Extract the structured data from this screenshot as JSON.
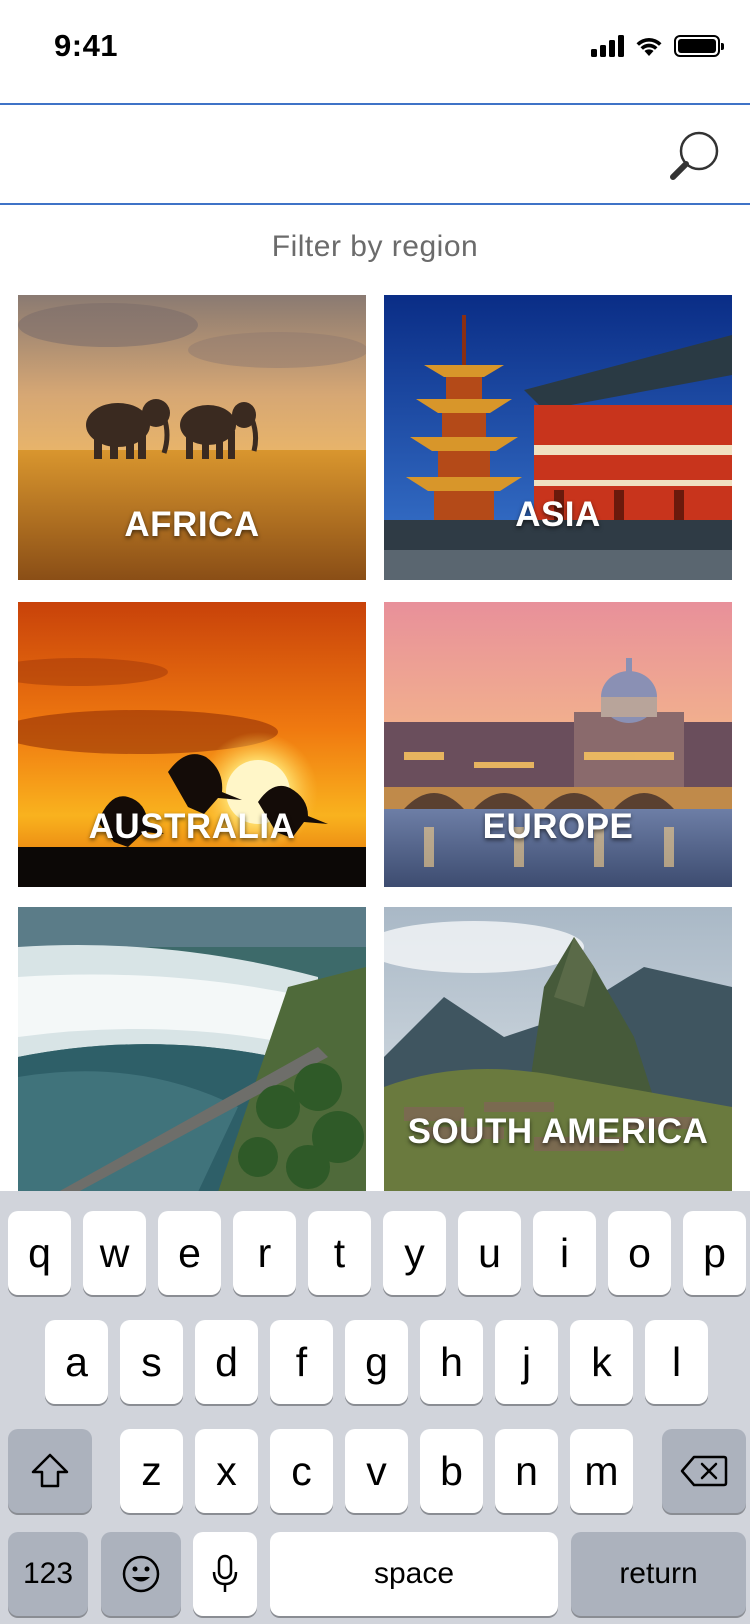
{
  "status_bar": {
    "time": "9:41"
  },
  "search": {
    "value": "",
    "placeholder": ""
  },
  "filter": {
    "label": "Filter by region"
  },
  "regions": [
    {
      "label": "AFRICA"
    },
    {
      "label": "ASIA"
    },
    {
      "label": "AUSTRALIA"
    },
    {
      "label": "EUROPE"
    },
    {
      "label": ""
    },
    {
      "label": "SOUTH AMERICA"
    }
  ],
  "keyboard": {
    "row1": [
      "q",
      "w",
      "e",
      "r",
      "t",
      "y",
      "u",
      "i",
      "o",
      "p"
    ],
    "row2": [
      "a",
      "s",
      "d",
      "f",
      "g",
      "h",
      "j",
      "k",
      "l"
    ],
    "row3": [
      "z",
      "x",
      "c",
      "v",
      "b",
      "n",
      "m"
    ],
    "numbers_label": "123",
    "space_label": "space",
    "return_label": "return"
  }
}
